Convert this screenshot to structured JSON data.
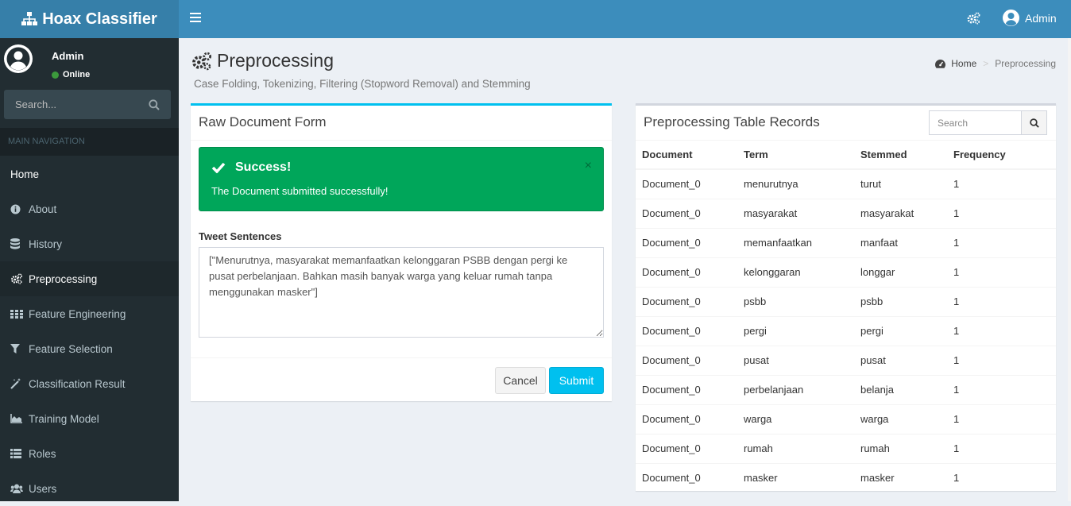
{
  "app": {
    "title": "Hoax Classifier"
  },
  "topbar": {
    "user": "Admin",
    "icons": [
      "bars-icon",
      "gears-icon",
      "user-circle-icon"
    ]
  },
  "sidebar": {
    "user": {
      "name": "Admin",
      "status": "Online"
    },
    "search": {
      "placeholder": "Search..."
    },
    "header": "MAIN NAVIGATION",
    "items": [
      {
        "label": "Home",
        "icon": ""
      },
      {
        "label": "About",
        "icon": "info-circle-icon"
      },
      {
        "label": "History",
        "icon": "database-icon"
      },
      {
        "label": "Preprocessing",
        "icon": "gears-icon"
      },
      {
        "label": "Feature Engineering",
        "icon": "th-icon"
      },
      {
        "label": "Feature Selection",
        "icon": "filter-icon"
      },
      {
        "label": "Classification Result",
        "icon": "magic-icon"
      },
      {
        "label": "Training Model",
        "icon": "area-chart-icon"
      },
      {
        "label": "Roles",
        "icon": "list-icon"
      },
      {
        "label": "Users",
        "icon": "users-icon"
      }
    ]
  },
  "page": {
    "title": "Preprocessing",
    "subtitle": "Case Folding, Tokenizing, Filtering (Stopword Removal) and Stemming",
    "breadcrumb": {
      "home": "Home",
      "current": "Preprocessing"
    }
  },
  "form": {
    "title": "Raw Document Form",
    "alert": {
      "title": "Success!",
      "message": "The Document submitted successfully!",
      "close": "×"
    },
    "label": "Tweet Sentences",
    "value": "[\"Menurutnya, masyarakat memanfaatkan kelonggaran PSBB dengan pergi ke pusat perbelanjaan. Bahkan masih banyak warga yang keluar rumah tanpa menggunakan masker\"]",
    "cancel": "Cancel",
    "submit": "Submit"
  },
  "table": {
    "title": "Preprocessing Table Records",
    "search_placeholder": "Search",
    "columns": [
      "Document",
      "Term",
      "Stemmed",
      "Frequency"
    ],
    "rows": [
      [
        "Document_0",
        "menurutnya",
        "turut",
        "1"
      ],
      [
        "Document_0",
        "masyarakat",
        "masyarakat",
        "1"
      ],
      [
        "Document_0",
        "memanfaatkan",
        "manfaat",
        "1"
      ],
      [
        "Document_0",
        "kelonggaran",
        "longgar",
        "1"
      ],
      [
        "Document_0",
        "psbb",
        "psbb",
        "1"
      ],
      [
        "Document_0",
        "pergi",
        "pergi",
        "1"
      ],
      [
        "Document_0",
        "pusat",
        "pusat",
        "1"
      ],
      [
        "Document_0",
        "perbelanjaan",
        "belanja",
        "1"
      ],
      [
        "Document_0",
        "warga",
        "warga",
        "1"
      ],
      [
        "Document_0",
        "rumah",
        "rumah",
        "1"
      ],
      [
        "Document_0",
        "masker",
        "masker",
        "1"
      ]
    ]
  },
  "colors": {
    "topbar": "#3c8dbc",
    "logo": "#367fa9",
    "sidebar": "#222d32",
    "success": "#00a65a",
    "info": "#00c0ef"
  }
}
